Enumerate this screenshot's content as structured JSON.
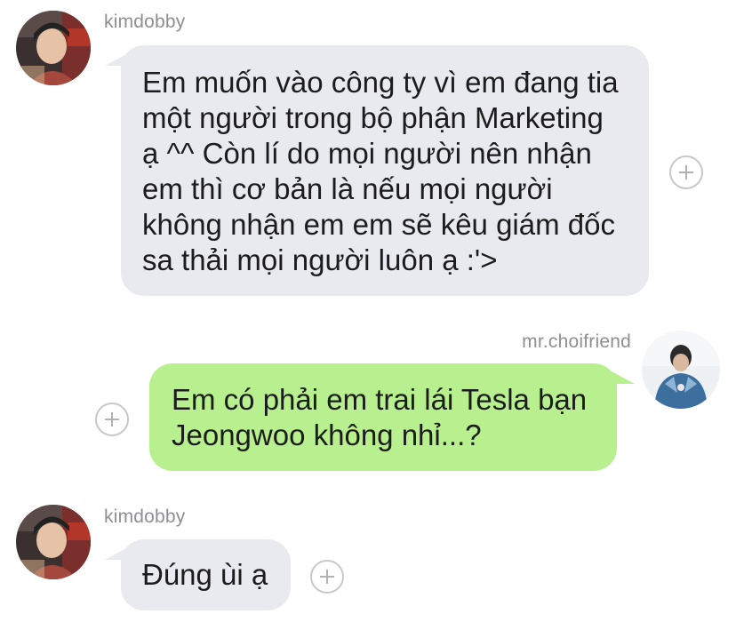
{
  "messages": [
    {
      "sender": "kimdobby",
      "direction": "received",
      "lines": [
        "Em muốn vào công ty vì em đang tia",
        "một người trong bộ phận Marketing",
        "ạ ^^ Còn lí do mọi người nên nhận",
        "em thì cơ bản là nếu mọi người",
        "không nhận em em sẽ kêu giám đốc",
        "sa thải mọi người luôn ạ :'>"
      ],
      "avatar_icon": "profile-photo-kimdobby",
      "react_icon": "plus-circle-icon"
    },
    {
      "sender": "mr.choifriend",
      "direction": "sent",
      "lines": [
        "Em có phải em trai lái Tesla bạn",
        "Jeongwoo không nhỉ...?"
      ],
      "avatar_icon": "profile-photo-mrchoifriend",
      "react_icon": "plus-circle-icon"
    },
    {
      "sender": "kimdobby",
      "direction": "received",
      "lines": [
        "Đúng ùi ạ"
      ],
      "avatar_icon": "profile-photo-kimdobby",
      "react_icon": "plus-circle-icon"
    }
  ],
  "colors": {
    "received_bubble": "#e9eaef",
    "sent_bubble": "#b8f08f",
    "username": "#8e8e93",
    "message_text": "#1c1c1e",
    "react_button": "#c7c7cc",
    "background": "#ffffff"
  }
}
